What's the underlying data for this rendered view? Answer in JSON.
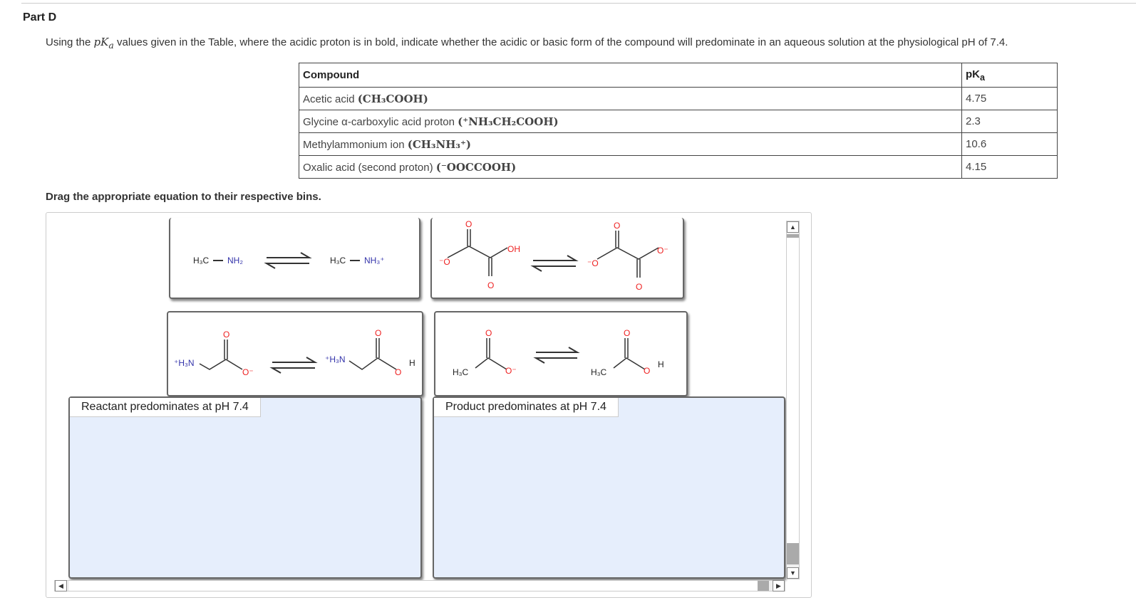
{
  "part_title": "Part D",
  "intro": {
    "pre": "Using the ",
    "pka": "pK",
    "pka_sub": "a",
    "post": " values given in the Table, where the acidic proton is in bold, indicate whether the acidic or basic form of the compound will predominate in an aqueous solution at the physiological pH of 7.4."
  },
  "table": {
    "headers": [
      "Compound",
      "pK",
      "a"
    ],
    "rows": [
      {
        "name": "Acetic acid ",
        "formula": "(CH₃COOH)",
        "pka": "4.75"
      },
      {
        "name": "Glycine α-carboxylic acid proton ",
        "formula": "(⁺NH₃CH₂COOH)",
        "pka": "2.3"
      },
      {
        "name": "Methylammonium ion ",
        "formula": "(CH₃NH₃⁺)",
        "pka": "10.6"
      },
      {
        "name": "Oxalic acid (second proton) ",
        "formula": "(⁻OOCCOOH)",
        "pka": "4.15"
      }
    ]
  },
  "instruction": "Drag the appropriate equation to their respective bins.",
  "labels": {
    "h3c": "H₃C",
    "nh2": "NH₂",
    "nh3p": "NH₃⁺",
    "h3np": "⁺H₃N",
    "o": "O",
    "om": "O⁻",
    "mo": "⁻O",
    "oh": "OH",
    "h": "H"
  },
  "bins": [
    "Reactant predominates at pH 7.4",
    "Product predominates at pH 7.4"
  ],
  "scroll": {
    "up": "▲",
    "down": "▼",
    "left": "◀",
    "right": "▶"
  }
}
